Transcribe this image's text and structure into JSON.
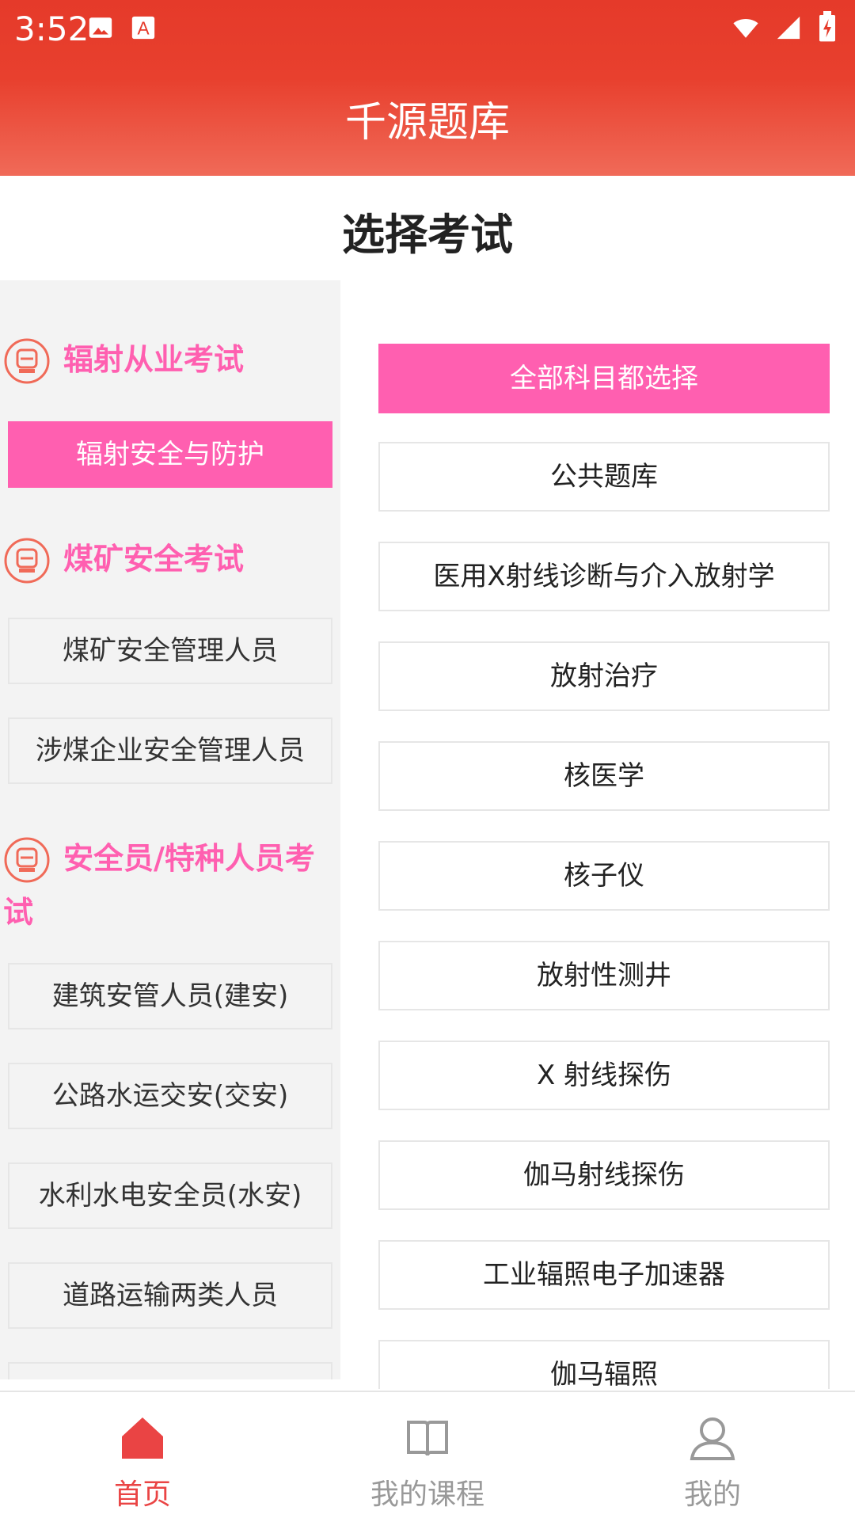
{
  "status_bar": {
    "time": "3:52",
    "icons": [
      "image-icon",
      "font-icon",
      "wifi-icon",
      "signal-icon",
      "battery-icon"
    ]
  },
  "app": {
    "title": "千源题库"
  },
  "page": {
    "title": "选择考试"
  },
  "colors": {
    "header": "#e53a2a",
    "accent_pink": "#ff5fb0",
    "nav_active": "#ea4444",
    "nav_inactive": "#999999"
  },
  "categories": [
    {
      "label": "辐射从业考试",
      "items": [
        "辐射安全与防护"
      ]
    },
    {
      "label": "煤矿安全考试",
      "items": [
        "煤矿安全管理人员",
        "涉煤企业安全管理人员"
      ]
    },
    {
      "label": "安全员/特种人员考试",
      "items": [
        "建筑安管人员(建安)",
        "公路水运交安(交安)",
        "水利水电安全员(水安)",
        "道路运输两类人员"
      ]
    }
  ],
  "subjects": {
    "select_all": "全部科目都选择",
    "items": [
      "公共题库",
      "医用X射线诊断与介入放射学",
      "放射治疗",
      "核医学",
      "核子仪",
      "放射性测井",
      "X 射线探伤",
      "伽马射线探伤",
      "工业辐照电子加速器",
      "伽马辐照"
    ]
  },
  "bottom_nav": [
    {
      "label": "首页",
      "icon": "home-icon",
      "active": true
    },
    {
      "label": "我的课程",
      "icon": "book-icon",
      "active": false
    },
    {
      "label": "我的",
      "icon": "user-icon",
      "active": false
    }
  ]
}
